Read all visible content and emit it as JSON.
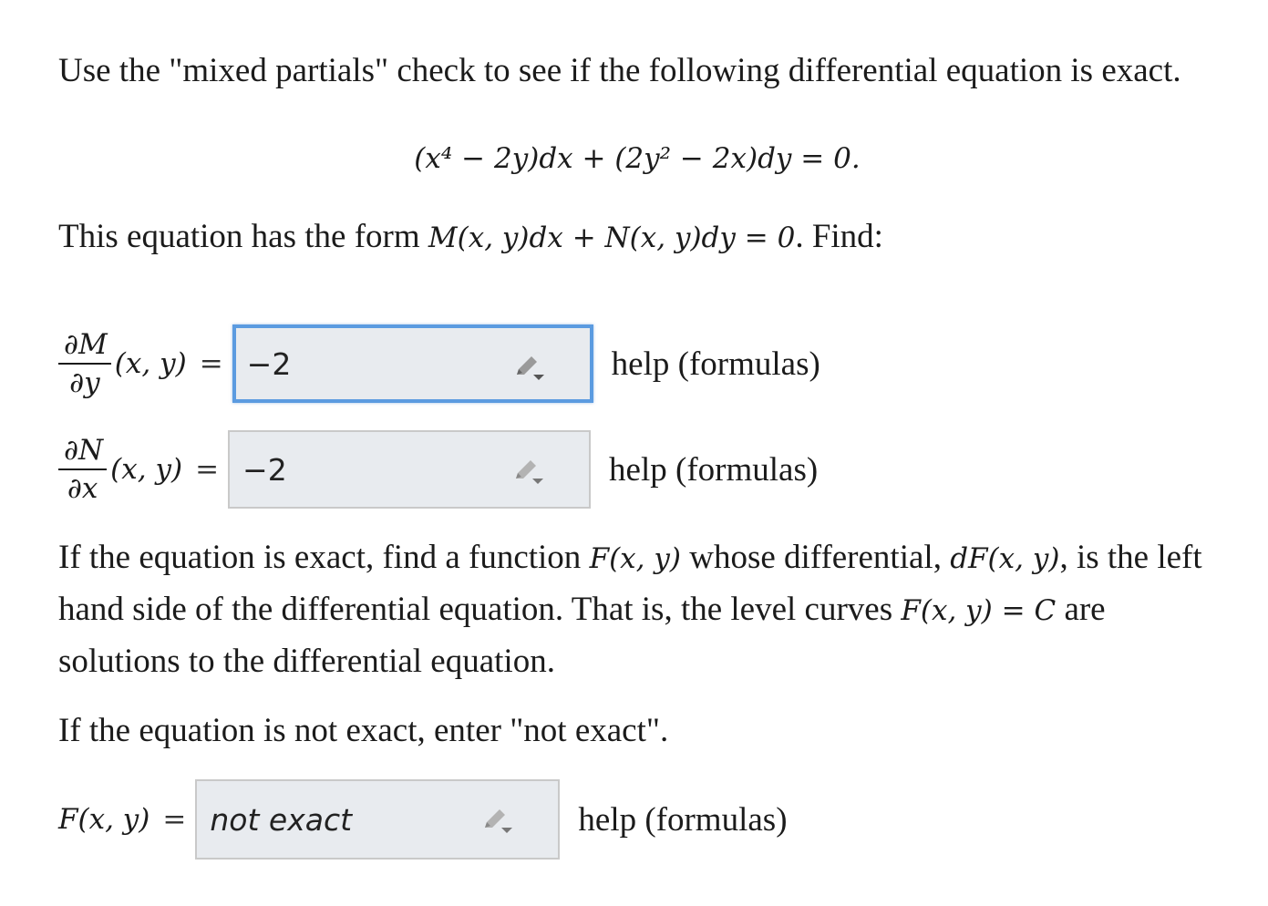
{
  "intro": {
    "line": "Use the \"mixed partials\" check to see if the following differential equation is exact."
  },
  "equation": {
    "display": "(x⁴ − 2y)dx + (2y² − 2x)dy = 0."
  },
  "form_sentence": {
    "prefix": "This equation has the form ",
    "math": "M(x, y)dx + N(x, y)dy = 0",
    "suffix": ". Find:"
  },
  "partial_M": {
    "numerator": "∂M",
    "denominator": "∂y",
    "args": "(x, y)",
    "equals": "=",
    "value": "−2",
    "help_label": "help (formulas)"
  },
  "partial_N": {
    "numerator": "∂N",
    "denominator": "∂x",
    "args": "(x, y)",
    "equals": "=",
    "value": "−2",
    "help_label": "help (formulas)"
  },
  "exact_instructions": {
    "p1_a": "If the equation is exact, find a function ",
    "p1_m1": "F(x, y)",
    "p1_b": " whose differential, ",
    "p1_m2": "dF(x, y)",
    "p1_c": ", is the left hand side of the differential equation. That is, the level curves ",
    "p1_m3": "F(x, y) = C",
    "p1_d": " are solutions to the differential equation.",
    "p2": "If the equation is not exact, enter \"not exact\"."
  },
  "F_answer": {
    "label": "F(x, y)",
    "equals": "=",
    "value": "not exact",
    "help_label": "help (formulas)"
  },
  "colors": {
    "focus_border": "#5b9be0",
    "input_bg": "#e8ebef",
    "input_border": "#c9c9c9"
  },
  "icons": {
    "editor": "pencil-icon"
  }
}
